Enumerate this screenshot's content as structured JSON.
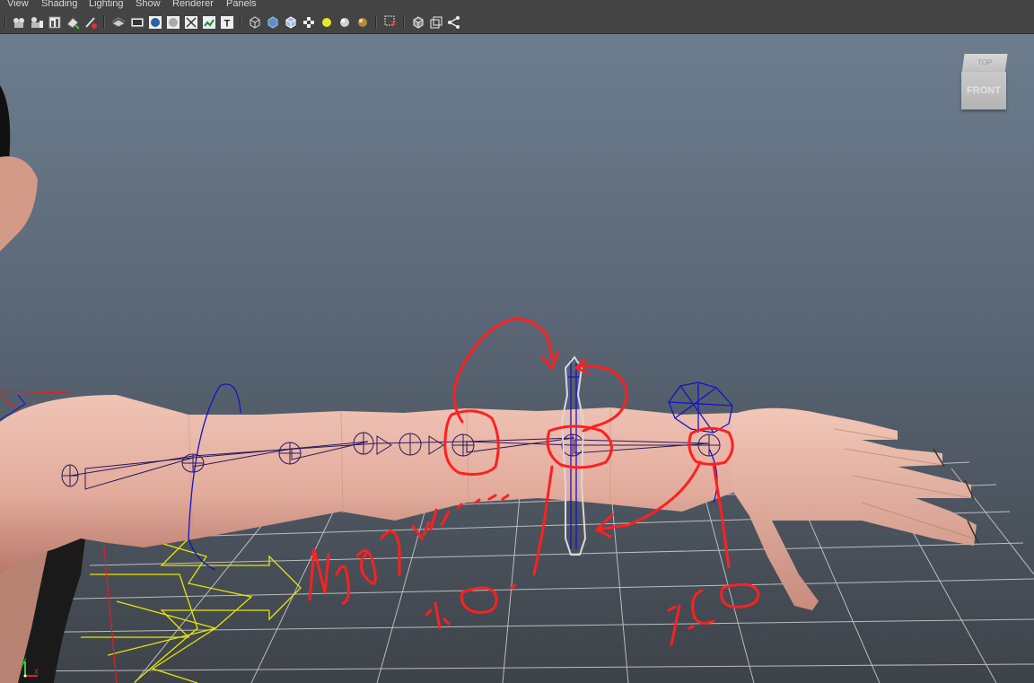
{
  "menu": {
    "items": [
      "View",
      "Shading",
      "Lighting",
      "Show",
      "Renderer",
      "Panels"
    ]
  },
  "toolbar": {
    "icons": [
      "select-camera-icon",
      "camera-attributes-icon",
      "image-plane-icon",
      "bookmark-icon",
      "grease-pencil-icon",
      "grid-toggle-icon",
      "film-gate-icon",
      "resolution-gate-icon",
      "gate-mask-icon",
      "field-chart-icon",
      "safe-action-icon",
      "safe-title-icon",
      "wireframe-icon",
      "smooth-shade-icon",
      "wireframe-on-shaded-icon",
      "textured-icon",
      "use-all-lights-icon",
      "shadows-icon",
      "ambient-occlusion-icon",
      "select-highlight-icon",
      "isolate-select-icon",
      "xray-icon",
      "xray-joints-icon"
    ]
  },
  "viewcube": {
    "top_label": "TOP",
    "front_label": "FRONT"
  },
  "axes": {
    "y_label": "y",
    "x_label": "x"
  },
  "annotations": {
    "label_left": "%10.",
    "label_right": "%50",
    "label_mid": "%1.0"
  },
  "colors": {
    "viewport_top": "#6d7d8e",
    "viewport_bottom": "#3e4349",
    "annotation": "#ff2020",
    "skin": "#e6b4a6",
    "joint_wire": "#2a1a5a",
    "control_blue": "#1414c8",
    "grid": "#d0d0d0",
    "yellow_controls": "#e6e600"
  }
}
